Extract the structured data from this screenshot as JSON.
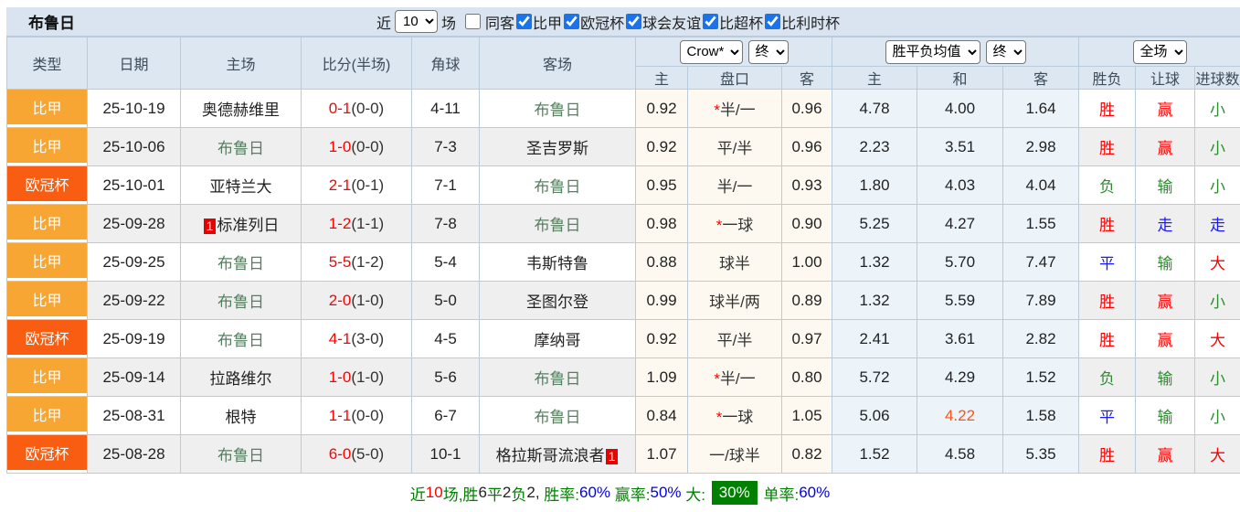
{
  "colors": {
    "panel_bg": "#d9e4f0",
    "header_bg": "#dce7f1",
    "border": "#b9ccde",
    "cream": "#fdf9f1",
    "lightblue": "#ecf4fa",
    "score_red": "#ff0000",
    "result_green": "#2e8b2e",
    "result_blue": "#1a1aff",
    "team_green": "#567f60",
    "hot_orange": "#ff5216",
    "league_jia_bg": "#f8a633",
    "league_cup_bg": "#f95d11",
    "badge_red": "#e60000",
    "footer_green": "#008000",
    "footer_blue": "#0000ee",
    "badge_green_bg": "#008000",
    "checkbox_blue": "#1a73e8"
  },
  "topbar": {
    "title": "布鲁日",
    "near_label": "近",
    "matches_value": "10",
    "matches_label": "场",
    "same_opponent": {
      "label": "同客",
      "checked": false
    },
    "leagues": [
      {
        "label": "比甲",
        "checked": true
      },
      {
        "label": "欧冠杯",
        "checked": true
      },
      {
        "label": "球会友谊",
        "checked": true
      },
      {
        "label": "比超杯",
        "checked": true
      },
      {
        "label": "比利时杯",
        "checked": true
      }
    ]
  },
  "table": {
    "left_headers": [
      "类型",
      "日期",
      "主场",
      "比分(半场)",
      "角球",
      "客场"
    ],
    "selects": {
      "handicap_company": "Crow*",
      "handicap_time": "终",
      "odds_type": "胜平负均值",
      "odds_time": "终",
      "scope": "全场"
    },
    "sub_headers": [
      "主",
      "盘口",
      "客",
      "主",
      "和",
      "客",
      "胜负",
      "让球",
      "进球数"
    ],
    "rows": [
      {
        "league": "比甲",
        "league_class": "jia",
        "date": "25-10-19",
        "home": "奥德赫维里",
        "home_focus": false,
        "home_badge": "",
        "score_ft": "0-1",
        "score_ht": "(0-0)",
        "corner": "4-11",
        "away": "布鲁日",
        "away_focus": true,
        "away_badge": "",
        "h1": "0.92",
        "line_star": true,
        "line": "半/一",
        "h2": "0.96",
        "o1": "4.78",
        "o2": "4.00",
        "o2_hot": false,
        "o3": "1.64",
        "results": [
          [
            "胜",
            "red"
          ],
          [
            "赢",
            "red"
          ],
          [
            "小",
            "green"
          ]
        ]
      },
      {
        "league": "比甲",
        "league_class": "jia",
        "date": "25-10-06",
        "home": "布鲁日",
        "home_focus": true,
        "home_badge": "",
        "score_ft": "1-0",
        "score_ht": "(0-0)",
        "corner": "7-3",
        "away": "圣吉罗斯",
        "away_focus": false,
        "away_badge": "",
        "h1": "0.92",
        "line_star": false,
        "line": "平/半",
        "h2": "0.96",
        "o1": "2.23",
        "o2": "3.51",
        "o2_hot": false,
        "o3": "2.98",
        "results": [
          [
            "胜",
            "red"
          ],
          [
            "赢",
            "red"
          ],
          [
            "小",
            "green"
          ]
        ]
      },
      {
        "league": "欧冠杯",
        "league_class": "cup",
        "date": "25-10-01",
        "home": "亚特兰大",
        "home_focus": false,
        "home_badge": "",
        "score_ft": "2-1",
        "score_ht": "(0-1)",
        "corner": "7-1",
        "away": "布鲁日",
        "away_focus": true,
        "away_badge": "",
        "h1": "0.95",
        "line_star": false,
        "line": "半/一",
        "h2": "0.93",
        "o1": "1.80",
        "o2": "4.03",
        "o2_hot": false,
        "o3": "4.04",
        "results": [
          [
            "负",
            "green"
          ],
          [
            "输",
            "green"
          ],
          [
            "小",
            "green"
          ]
        ]
      },
      {
        "league": "比甲",
        "league_class": "jia",
        "date": "25-09-28",
        "home": "标准列日",
        "home_focus": false,
        "home_badge": "1",
        "score_ft": "1-2",
        "score_ht": "(1-1)",
        "corner": "7-8",
        "away": "布鲁日",
        "away_focus": true,
        "away_badge": "",
        "h1": "0.98",
        "line_star": true,
        "line": "一球",
        "h2": "0.90",
        "o1": "5.25",
        "o2": "4.27",
        "o2_hot": false,
        "o3": "1.55",
        "results": [
          [
            "胜",
            "red"
          ],
          [
            "走",
            "blue"
          ],
          [
            "走",
            "blue"
          ]
        ]
      },
      {
        "league": "比甲",
        "league_class": "jia",
        "date": "25-09-25",
        "home": "布鲁日",
        "home_focus": true,
        "home_badge": "",
        "score_ft": "5-5",
        "score_ht": "(1-2)",
        "corner": "5-4",
        "away": "韦斯特鲁",
        "away_focus": false,
        "away_badge": "",
        "h1": "0.88",
        "line_star": false,
        "line": "球半",
        "h2": "1.00",
        "o1": "1.32",
        "o2": "5.70",
        "o2_hot": false,
        "o3": "7.47",
        "results": [
          [
            "平",
            "blue"
          ],
          [
            "输",
            "green"
          ],
          [
            "大",
            "red"
          ]
        ]
      },
      {
        "league": "比甲",
        "league_class": "jia",
        "date": "25-09-22",
        "home": "布鲁日",
        "home_focus": true,
        "home_badge": "",
        "score_ft": "2-0",
        "score_ht": "(1-0)",
        "corner": "5-0",
        "away": "圣图尔登",
        "away_focus": false,
        "away_badge": "",
        "h1": "0.99",
        "line_star": false,
        "line": "球半/两",
        "h2": "0.89",
        "o1": "1.32",
        "o2": "5.59",
        "o2_hot": false,
        "o3": "7.89",
        "results": [
          [
            "胜",
            "red"
          ],
          [
            "赢",
            "red"
          ],
          [
            "小",
            "green"
          ]
        ]
      },
      {
        "league": "欧冠杯",
        "league_class": "cup",
        "date": "25-09-19",
        "home": "布鲁日",
        "home_focus": true,
        "home_badge": "",
        "score_ft": "4-1",
        "score_ht": "(3-0)",
        "corner": "4-5",
        "away": "摩纳哥",
        "away_focus": false,
        "away_badge": "",
        "h1": "0.92",
        "line_star": false,
        "line": "平/半",
        "h2": "0.97",
        "o1": "2.41",
        "o2": "3.61",
        "o2_hot": false,
        "o3": "2.82",
        "results": [
          [
            "胜",
            "red"
          ],
          [
            "赢",
            "red"
          ],
          [
            "大",
            "red"
          ]
        ]
      },
      {
        "league": "比甲",
        "league_class": "jia",
        "date": "25-09-14",
        "home": "拉路维尔",
        "home_focus": false,
        "home_badge": "",
        "score_ft": "1-0",
        "score_ht": "(1-0)",
        "corner": "5-6",
        "away": "布鲁日",
        "away_focus": true,
        "away_badge": "",
        "h1": "1.09",
        "line_star": true,
        "line": "半/一",
        "h2": "0.80",
        "o1": "5.72",
        "o2": "4.29",
        "o2_hot": false,
        "o3": "1.52",
        "results": [
          [
            "负",
            "green"
          ],
          [
            "输",
            "green"
          ],
          [
            "小",
            "green"
          ]
        ]
      },
      {
        "league": "比甲",
        "league_class": "jia",
        "date": "25-08-31",
        "home": "根特",
        "home_focus": false,
        "home_badge": "",
        "score_ft": "1-1",
        "score_ht": "(0-0)",
        "corner": "6-7",
        "away": "布鲁日",
        "away_focus": true,
        "away_badge": "",
        "h1": "0.84",
        "line_star": true,
        "line": "一球",
        "h2": "1.05",
        "o1": "5.06",
        "o2": "4.22",
        "o2_hot": true,
        "o3": "1.58",
        "results": [
          [
            "平",
            "blue"
          ],
          [
            "输",
            "green"
          ],
          [
            "小",
            "green"
          ]
        ]
      },
      {
        "league": "欧冠杯",
        "league_class": "cup",
        "date": "25-08-28",
        "home": "布鲁日",
        "home_focus": true,
        "home_badge": "",
        "score_ft": "6-0",
        "score_ht": "(5-0)",
        "corner": "10-1",
        "away": "格拉斯哥流浪者",
        "away_focus": false,
        "away_badge": "1",
        "h1": "1.07",
        "line_star": false,
        "line": "一/球半",
        "h2": "0.82",
        "o1": "1.52",
        "o2": "4.58",
        "o2_hot": false,
        "o3": "5.35",
        "results": [
          [
            "胜",
            "red"
          ],
          [
            "赢",
            "red"
          ],
          [
            "大",
            "red"
          ]
        ]
      }
    ]
  },
  "footer": {
    "segments": [
      {
        "text": "近",
        "cls": "green"
      },
      {
        "text": "10",
        "cls": "red"
      },
      {
        "text": "场,胜",
        "cls": "green"
      },
      {
        "text": "6",
        "cls": "dark"
      },
      {
        "text": "平",
        "cls": "green"
      },
      {
        "text": "2",
        "cls": "dark"
      },
      {
        "text": "负",
        "cls": "green"
      },
      {
        "text": "2, ",
        "cls": "dark"
      },
      {
        "text": "胜率:",
        "cls": "green"
      },
      {
        "text": "60%",
        "cls": "blue"
      },
      {
        "text": " 赢率:",
        "cls": "green"
      },
      {
        "text": "50%",
        "cls": "blue"
      },
      {
        "text": " 大: ",
        "cls": "green"
      },
      {
        "text": "30%",
        "cls": "badge"
      },
      {
        "text": " 单率:",
        "cls": "green"
      },
      {
        "text": "60%",
        "cls": "blue"
      }
    ]
  }
}
